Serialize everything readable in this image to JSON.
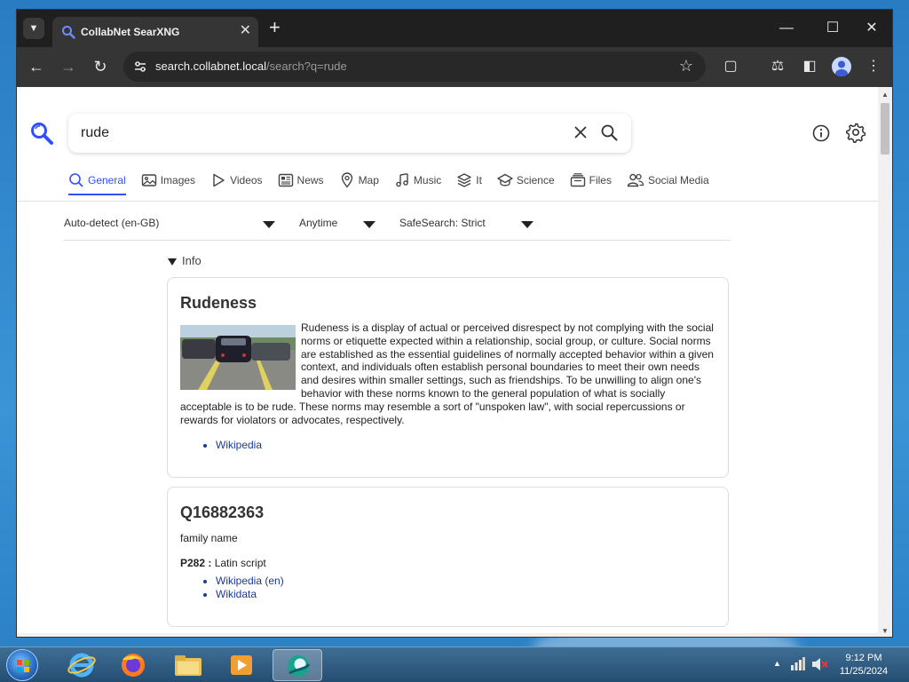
{
  "browser": {
    "tab_title": "CollabNet SearXNG",
    "url_host": "search.collabnet.local",
    "url_path": "/search?q=rude"
  },
  "search": {
    "query": "rude"
  },
  "categories": [
    {
      "label": "General",
      "icon": "search-icon",
      "active": true
    },
    {
      "label": "Images",
      "icon": "image-icon",
      "active": false
    },
    {
      "label": "Videos",
      "icon": "play-icon",
      "active": false
    },
    {
      "label": "News",
      "icon": "newspaper-icon",
      "active": false
    },
    {
      "label": "Map",
      "icon": "map-pin-icon",
      "active": false
    },
    {
      "label": "Music",
      "icon": "music-icon",
      "active": false
    },
    {
      "label": "It",
      "icon": "layers-icon",
      "active": false
    },
    {
      "label": "Science",
      "icon": "science-icon",
      "active": false
    },
    {
      "label": "Files",
      "icon": "files-icon",
      "active": false
    },
    {
      "label": "Social Media",
      "icon": "people-icon",
      "active": false
    }
  ],
  "filters": {
    "language": "Auto-detect (en-GB)",
    "time": "Anytime",
    "safesearch": "SafeSearch: Strict"
  },
  "infobox_toggle": "Info",
  "infobox1": {
    "title": "Rudeness",
    "text": "Rudeness is a display of actual or perceived disrespect by not complying with the social norms or etiquette expected within a relationship, social group, or culture. Social norms are established as the essential guidelines of normally accepted behavior within a given context, and individuals often establish personal boundaries to meet their own needs and desires within smaller settings, such as friendships. To be unwilling to align one's behavior with these norms known to the general population of what is socially acceptable is to be rude. These norms may resemble a sort of \"unspoken law\", with social repercussions or rewards for violators or advocates, respectively.",
    "links": [
      "Wikipedia"
    ]
  },
  "infobox2": {
    "title": "Q16882363",
    "subtitle": "family name",
    "prop_key": "P282 :",
    "prop_value": "Latin script",
    "links": [
      "Wikipedia (en)",
      "Wikidata"
    ]
  },
  "taskbar": {
    "time": "9:12 PM",
    "date": "11/25/2024"
  },
  "colors": {
    "accent": "#3050ff",
    "link": "#1b3b8f"
  }
}
